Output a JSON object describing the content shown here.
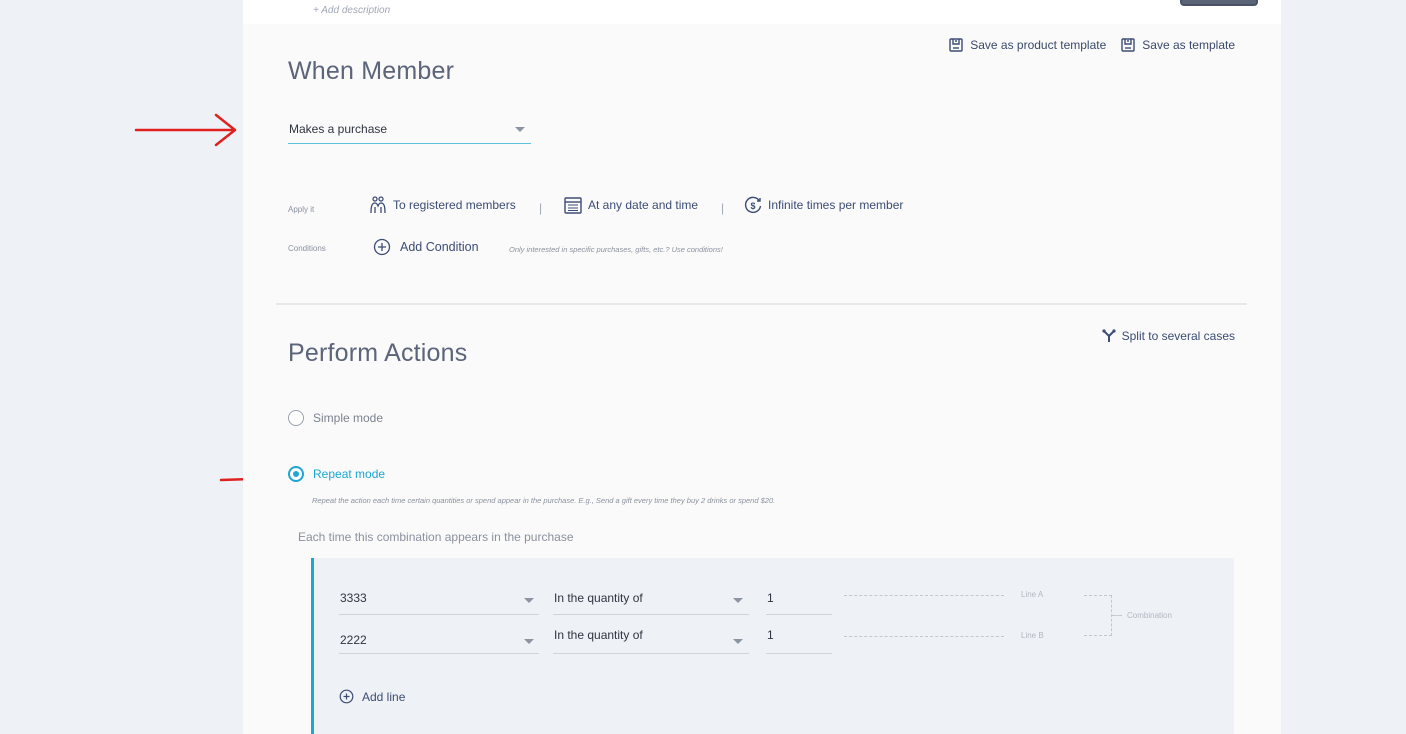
{
  "header": {
    "add_description": "+ Add description"
  },
  "templates": {
    "save_product_template": "Save as product template",
    "save_template": "Save as template"
  },
  "when": {
    "title": "When Member",
    "trigger_value": "Makes a purchase",
    "apply_label": "Apply it",
    "apply_items": [
      "To registered members",
      "At any date and time",
      "Infinite times per member"
    ],
    "separator": "|",
    "conditions_label": "Conditions",
    "add_condition": "Add Condition",
    "conditions_hint": "Only interested in specific purchases, gifts, etc.? Use conditions!"
  },
  "actions": {
    "title": "Perform Actions",
    "split_label": "Split to several cases",
    "simple_mode": "Simple mode",
    "repeat_mode": "Repeat mode",
    "repeat_description": "Repeat the action each time certain quantities or spend appear in the purchase. E.g., Send a gift every time they buy 2 drinks or spend $20.",
    "combination_title": "Each time this combination appears in the purchase",
    "lines": [
      {
        "item": "3333",
        "condition": "In the quantity of",
        "quantity": "1",
        "label": "Line A"
      },
      {
        "item": "2222",
        "condition": "In the quantity of",
        "quantity": "1",
        "label": "Line B"
      }
    ],
    "combination_label": "Combination",
    "add_line": "Add line"
  },
  "colors": {
    "accent": "#1ba6d3",
    "link": "#3c4c74",
    "annotation_arrow": "#e0201f"
  },
  "icons": [
    "save-template-icon",
    "members-icon",
    "calendar-icon",
    "infinite-times-icon",
    "add-circle-icon",
    "split-icon",
    "chevron-down-icon",
    "annotation-arrow-icon"
  ]
}
